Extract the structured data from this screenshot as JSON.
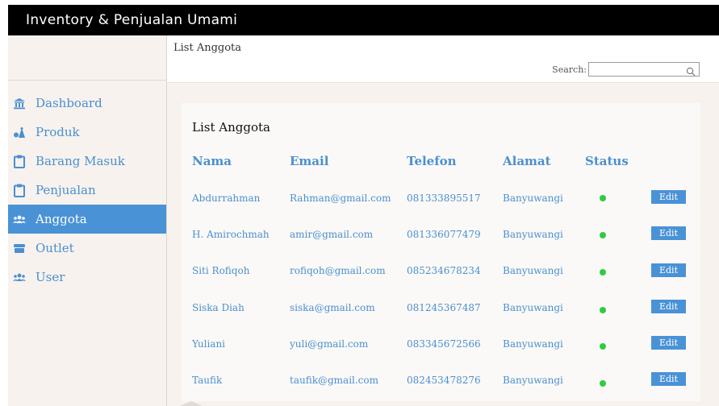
{
  "app": {
    "title": "Inventory & Penjualan Umami"
  },
  "sidebar": {
    "items": [
      {
        "label": "Dashboard",
        "icon": "bank-icon",
        "active": false
      },
      {
        "label": "Produk",
        "icon": "produk-icon",
        "active": false
      },
      {
        "label": "Barang Masuk",
        "icon": "clipboard-icon",
        "active": false
      },
      {
        "label": "Penjualan",
        "icon": "clipboard-icon",
        "active": false
      },
      {
        "label": "Anggota",
        "icon": "users-icon",
        "active": true
      },
      {
        "label": "Outlet",
        "icon": "store-icon",
        "active": false
      },
      {
        "label": "User",
        "icon": "users-icon",
        "active": false
      }
    ]
  },
  "header": {
    "breadcrumb": "List Anggota",
    "search_label": "Search:",
    "search_value": ""
  },
  "card": {
    "title": "List Anggota",
    "columns": [
      "Nama",
      "Email",
      "Telefon",
      "Alamat",
      "Status"
    ],
    "edit_label": "Edit",
    "rows": [
      {
        "nama": "Abdurrahman",
        "email": "Rahman@gmail.com",
        "telefon": "081333895517",
        "alamat": "Banyuwangi",
        "status": "active"
      },
      {
        "nama": "H. Amirochmah",
        "email": "amir@gmail.com",
        "telefon": "081336077479",
        "alamat": "Banyuwangi",
        "status": "active"
      },
      {
        "nama": "Siti Rofiqoh",
        "email": "rofiqoh@gmail.com",
        "telefon": "085234678234",
        "alamat": "Banyuwangi",
        "status": "active"
      },
      {
        "nama": "Siska Diah",
        "email": "siska@gmail.com",
        "telefon": "081245367487",
        "alamat": "Banyuwangi",
        "status": "active"
      },
      {
        "nama": "Yuliani",
        "email": "yuli@gmail.com",
        "telefon": "083345672566",
        "alamat": "Banyuwangi",
        "status": "active"
      },
      {
        "nama": "Taufik",
        "email": "taufik@gmail.com",
        "telefon": "082453478276",
        "alamat": "Banyuwangi",
        "status": "active"
      }
    ]
  },
  "colors": {
    "accent": "#4a92d6",
    "link": "#4a8fd1",
    "status_active": "#2ecc40",
    "titlebar": "#000000",
    "sidebar_bg": "#f7f2ee"
  }
}
